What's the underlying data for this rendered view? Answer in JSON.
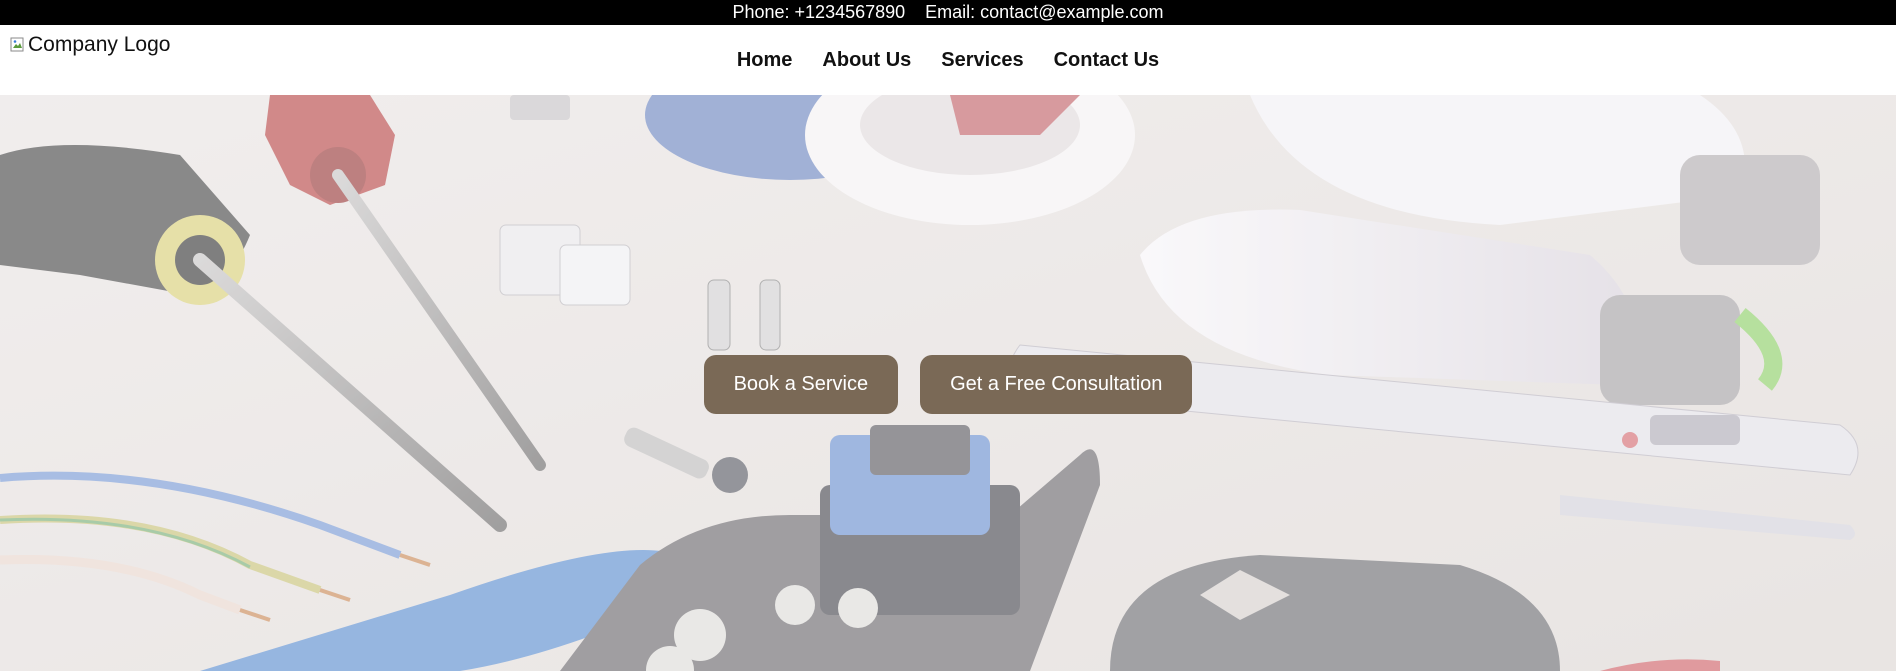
{
  "topbar": {
    "phone": "Phone: +1234567890",
    "email": "Email: contact@example.com"
  },
  "header": {
    "logo_alt": "Company Logo",
    "nav": [
      "Home",
      "About Us",
      "Services",
      "Contact Us"
    ]
  },
  "hero": {
    "buttons": [
      "Book a Service",
      "Get a Free Consultation"
    ]
  },
  "colors": {
    "topbar_bg": "#000000",
    "button_bg": "#7a6956",
    "hero_bg": "#ece9e7"
  }
}
